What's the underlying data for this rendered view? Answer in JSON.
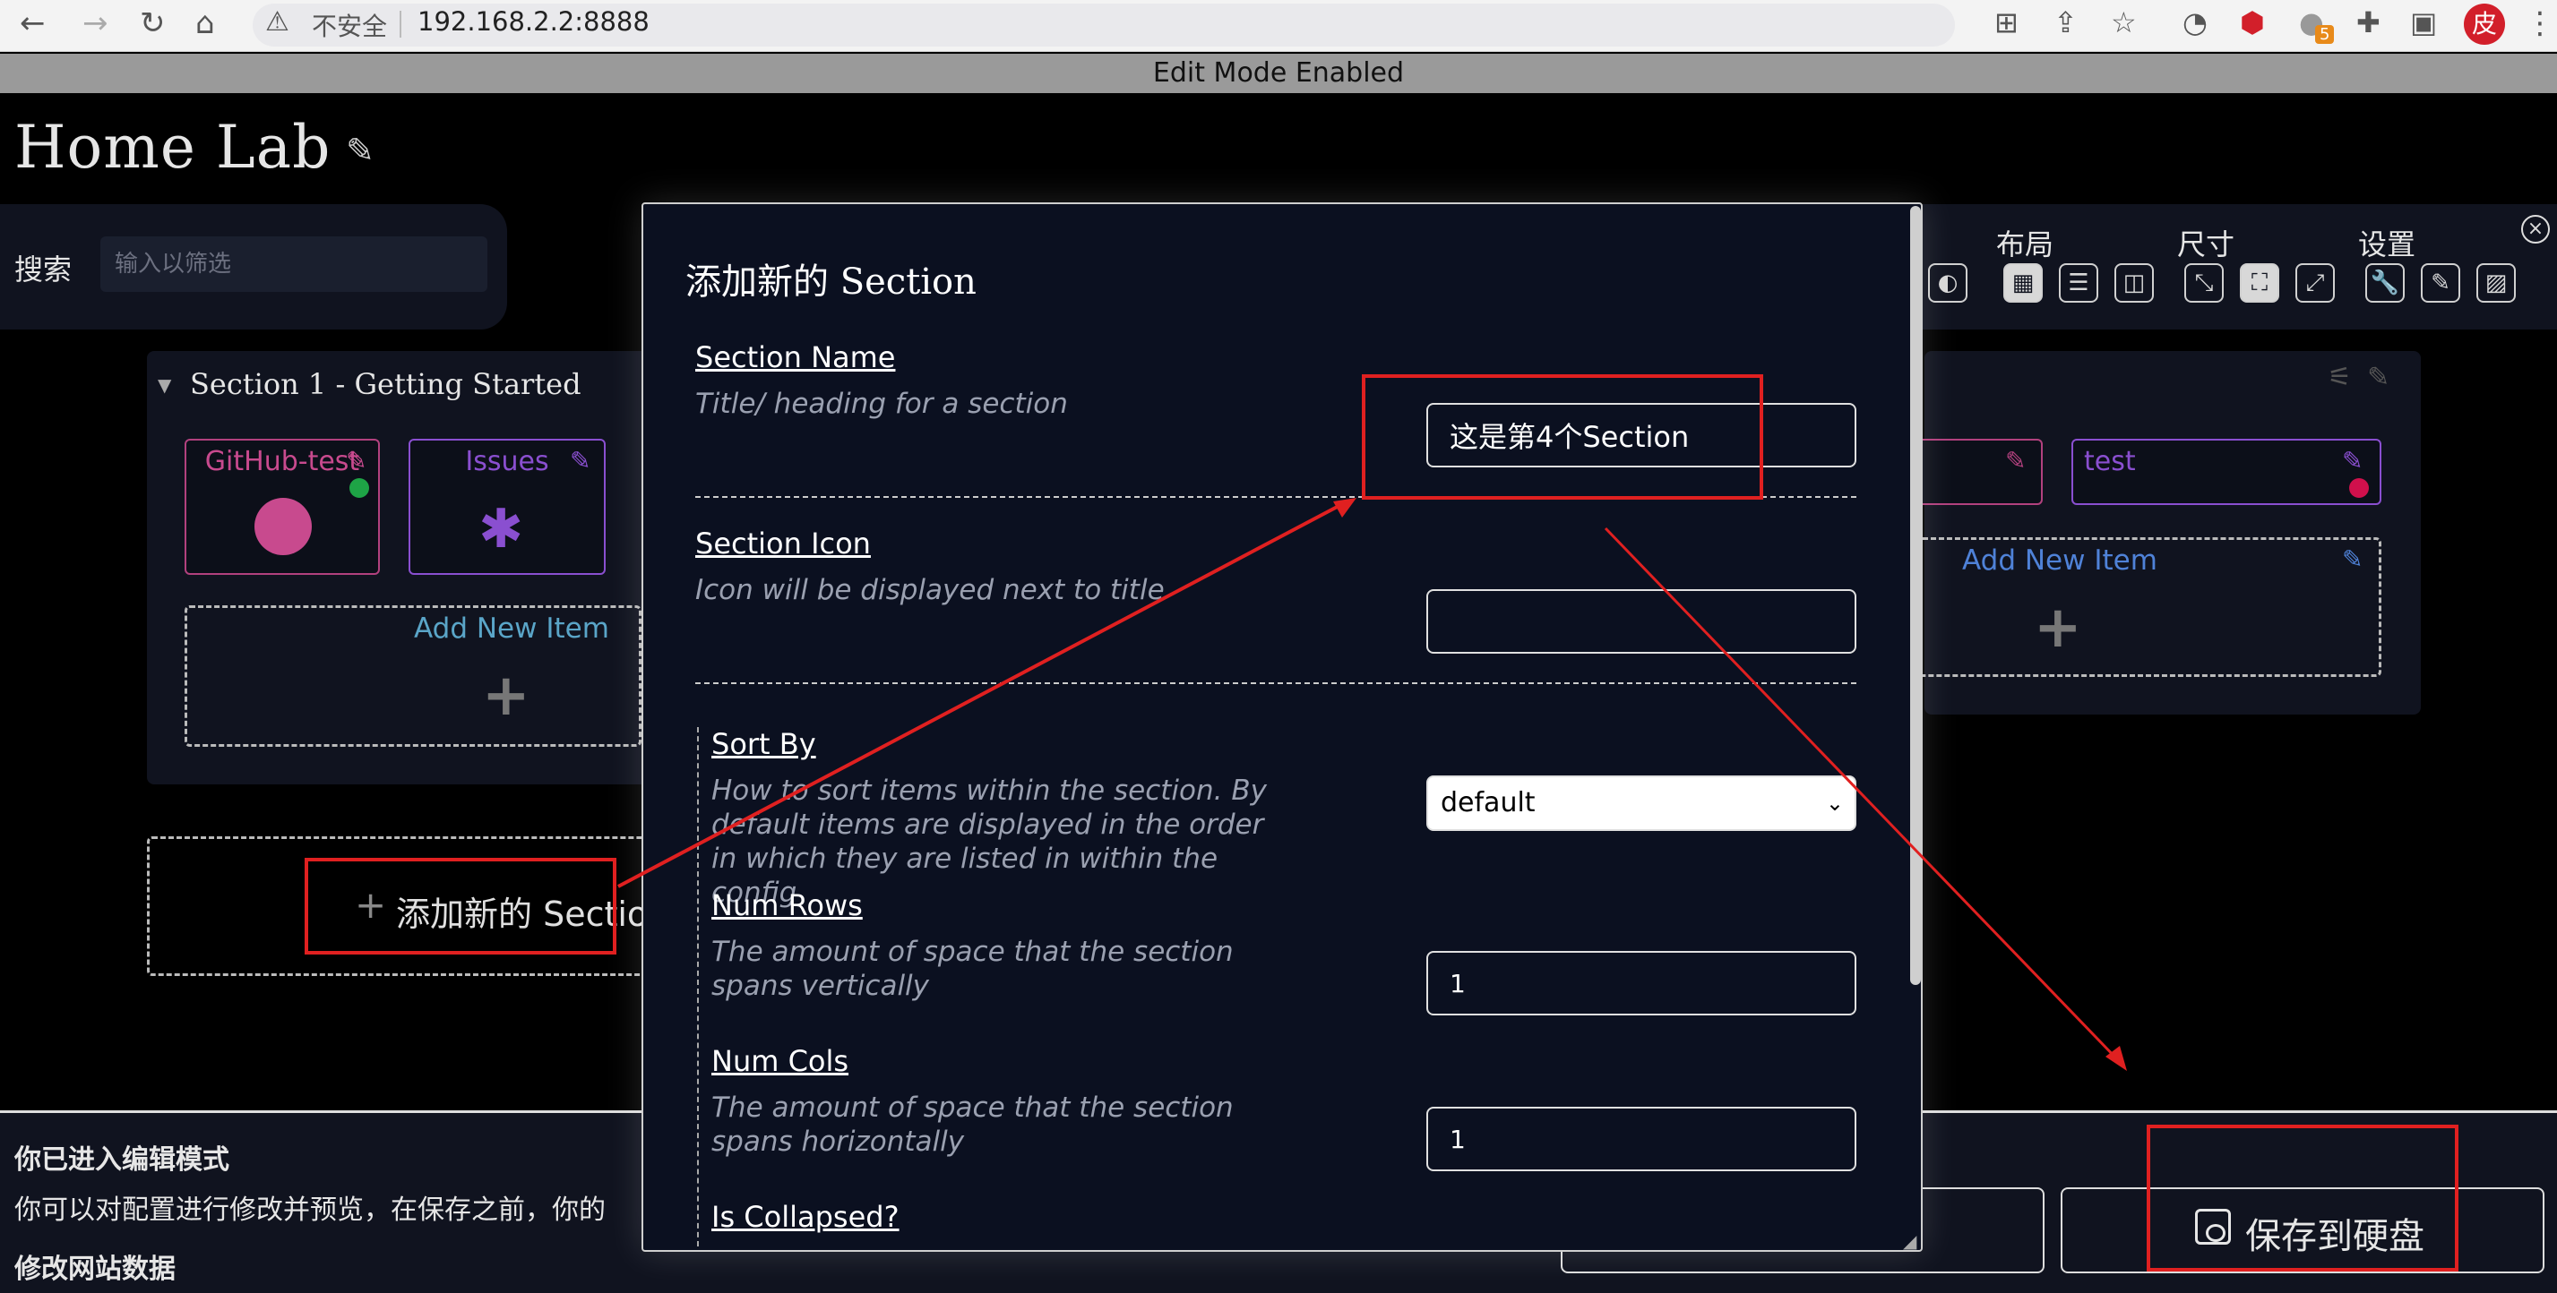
{
  "browser": {
    "security_label": "不安全",
    "url": "192.168.2.2:8888",
    "ext_badge": "5",
    "avatar_text": "皮"
  },
  "banner": {
    "text": "Edit Mode Enabled"
  },
  "app": {
    "title": "Home Lab",
    "search": {
      "label": "搜索",
      "placeholder": "输入以筛选"
    },
    "settings": {
      "layout_label": "布局",
      "size_label": "尺寸",
      "config_label": "设置"
    }
  },
  "section1": {
    "title": "Section 1 - Getting Started",
    "items": [
      {
        "label": "GitHub-test",
        "status_color": "#1ea446"
      },
      {
        "label": "Issues"
      }
    ],
    "add_item": "Add New Item"
  },
  "section_right": {
    "items": [
      {
        "label": "test",
        "status_color": "#d0104c"
      }
    ],
    "add_item": "Add New Item"
  },
  "add_section": {
    "label": "添加新的 Sectio"
  },
  "modal": {
    "title": "添加新的 Section",
    "fields": {
      "name": {
        "label": "Section Name",
        "desc": "Title/ heading for a section",
        "value": "这是第4个Section"
      },
      "icon": {
        "label": "Section Icon",
        "desc": "Icon will be displayed next to title",
        "value": ""
      },
      "sort": {
        "label": "Sort By",
        "desc": "How to sort items within the section. By default items are displayed in the order in which they are listed in within the config",
        "value": "default"
      },
      "rows": {
        "label": "Num Rows",
        "desc": "The amount of space that the section spans vertically",
        "value": "1"
      },
      "cols": {
        "label": "Num Cols",
        "desc": "The amount of space that the section spans horizontally",
        "value": "1"
      },
      "collapsed": {
        "label": "Is Collapsed?"
      }
    }
  },
  "bottom": {
    "title": "你已进入编辑模式",
    "text": "你可以对配置进行修改并预览，在保存之前，你的",
    "sub": "修改网站数据",
    "save_button": "保存到硬盘"
  },
  "colors": {
    "accent_pink": "#b2417e",
    "accent_purple": "#8a4fd0",
    "annotation_red": "#e02020"
  }
}
